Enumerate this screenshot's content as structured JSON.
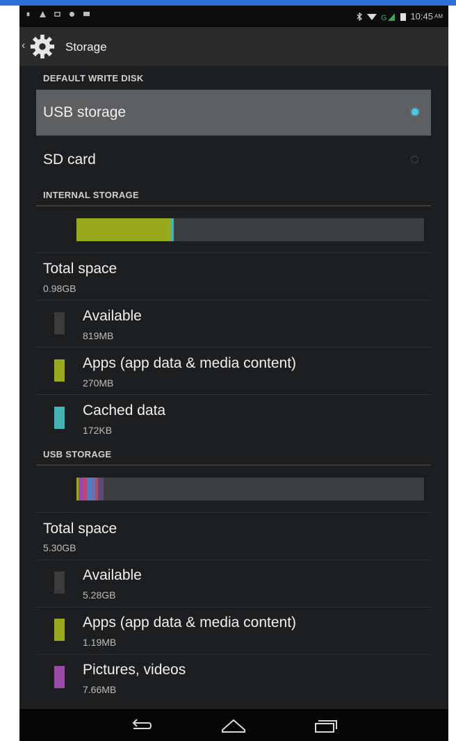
{
  "statusbar": {
    "time": "10:45",
    "ampm": "AM"
  },
  "appbar": {
    "title": "Storage",
    "icon": "gear-icon"
  },
  "default_write_disk": {
    "header": "DEFAULT WRITE DISK",
    "options": [
      {
        "label": "USB storage",
        "selected": true
      },
      {
        "label": "SD card",
        "selected": false
      }
    ]
  },
  "internal": {
    "header": "INTERNAL STORAGE",
    "total_label": "Total space",
    "total_value": "0.98GB",
    "usage": [
      {
        "label": "Available",
        "value": "819MB",
        "color": "#3b3b3b"
      },
      {
        "label": "Apps (app data & media content)",
        "value": "270MB",
        "color": "#9aa81e"
      },
      {
        "label": "Cached data",
        "value": "172KB",
        "color": "#45b3b3"
      }
    ],
    "bar_fractions": {
      "apps": 0.27,
      "cached": 0.018
    }
  },
  "usb": {
    "header": "USB STORAGE",
    "total_label": "Total space",
    "total_value": "5.30GB",
    "usage": [
      {
        "label": "Available",
        "value": "5.28GB",
        "color": "#3b3b3b"
      },
      {
        "label": "Apps (app data & media content)",
        "value": "1.19MB",
        "color": "#9aa81e"
      },
      {
        "label": "Pictures, videos",
        "value": "7.66MB",
        "color": "#9b4aa8"
      }
    ]
  },
  "colors": {
    "accent": "#4ec6e6",
    "background": "#1d1e20",
    "selected_row": "#5d5e60"
  }
}
